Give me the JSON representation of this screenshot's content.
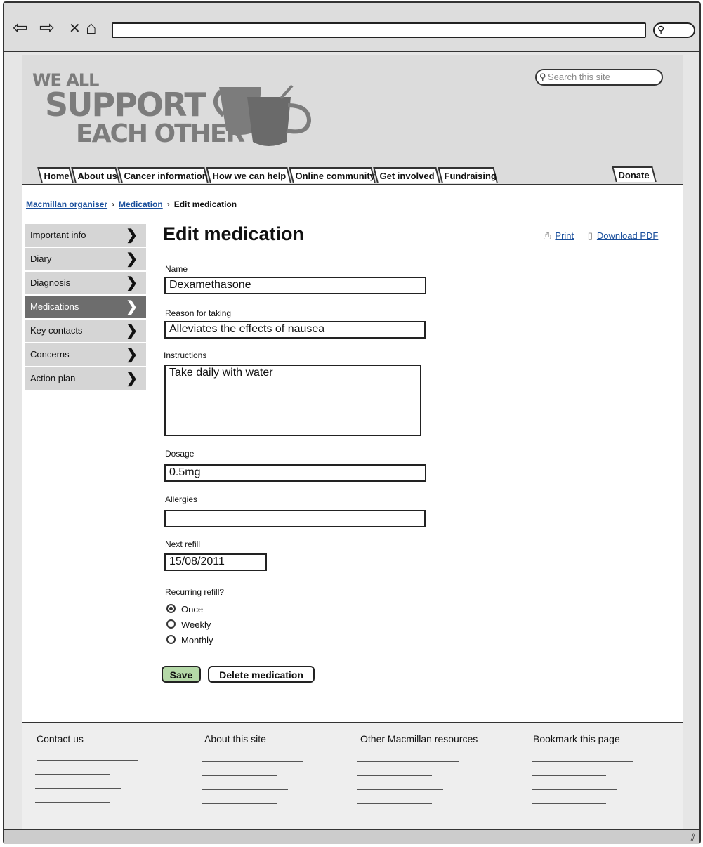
{
  "browser": {
    "back_icon": "back-arrow-icon",
    "forward_icon": "forward-arrow-icon",
    "stop_icon": "close-icon",
    "home_icon": "home-icon",
    "url": ""
  },
  "header": {
    "logo": {
      "line1": "WE ALL",
      "line2": "SUPPORT",
      "line3": "EACH OTHER"
    },
    "search_placeholder": "Search this site",
    "tabs": [
      "Home",
      "About us",
      "Cancer information",
      "How we can help",
      "Online community",
      "Get involved",
      "Fundraising"
    ],
    "donate": "Donate"
  },
  "breadcrumb": {
    "item1": "Macmillan organiser",
    "item2": "Medication",
    "current": "Edit medication"
  },
  "sidebar": {
    "items": [
      {
        "label": "Important info"
      },
      {
        "label": "Diary"
      },
      {
        "label": "Diagnosis"
      },
      {
        "label": "Medications",
        "active": true
      },
      {
        "label": "Key contacts"
      },
      {
        "label": "Concerns"
      },
      {
        "label": "Action plan"
      }
    ]
  },
  "main": {
    "title": "Edit medication",
    "print": "Print",
    "download": "Download PDF",
    "form": {
      "name_label": "Name",
      "name_value": "Dexamethasone",
      "reason_label": "Reason for taking",
      "reason_value": "Alleviates the effects of nausea",
      "instructions_label": "Instructions",
      "instructions_value": "Take daily with water",
      "dosage_label": "Dosage",
      "dosage_value": "0.5mg",
      "allergies_label": "Allergies",
      "allergies_value": "",
      "next_refill_label": "Next refill",
      "next_refill_value": "15/08/2011",
      "recurring_label": "Recurring refill?",
      "options": [
        "Once",
        "Weekly",
        "Monthly"
      ],
      "selected": "Once"
    },
    "save": "Save",
    "delete": "Delete medication"
  },
  "footer": {
    "cols": [
      "Contact us",
      "About this site",
      "Other Macmillan resources",
      "Bookmark this page"
    ]
  }
}
